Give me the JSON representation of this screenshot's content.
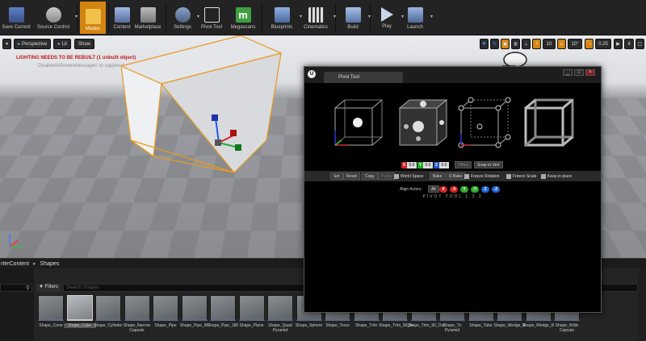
{
  "toolbar": {
    "items": [
      {
        "label": "Save Current",
        "icon": "save-icon"
      },
      {
        "label": "Source Control",
        "icon": "source-control-icon"
      },
      {
        "label": "Modes",
        "icon": "modes-icon"
      },
      {
        "label": "Content",
        "icon": "content-icon"
      },
      {
        "label": "Marketplace",
        "icon": "marketplace-icon"
      },
      {
        "label": "Settings",
        "icon": "settings-icon"
      },
      {
        "label": "Pivot Tool",
        "icon": "pivot-tool-icon"
      },
      {
        "label": "Megascans",
        "icon": "megascans-icon"
      },
      {
        "label": "Blueprints",
        "icon": "blueprints-icon"
      },
      {
        "label": "Cinematics",
        "icon": "cinematics-icon"
      },
      {
        "label": "Build",
        "icon": "build-icon"
      },
      {
        "label": "Play",
        "icon": "play-icon"
      },
      {
        "label": "Launch",
        "icon": "launch-icon"
      }
    ],
    "active_color": "#d48410"
  },
  "viewport": {
    "perspective_label": "Perspective",
    "lit_label": "Lit",
    "show_label": "Show",
    "warning": "LIGHTING NEEDS TO BE REBUILT (1 unbuilt object)",
    "warning_sub": "'DisableAllScreenMessages' to suppress",
    "grid_snap": "10",
    "rot_snap": "10°",
    "scale_snap": "0.25",
    "camera_speed": "4"
  },
  "content_browser": {
    "path_root": "rterContent",
    "path_leaf": "Shapes",
    "filters_label": "Filters",
    "search_placeholder": "Search Shapes",
    "assets": [
      "Shape_Cone",
      "Shape_Cube",
      "Shape_Cylinder",
      "Shape_Narrow Capsule",
      "Shape_Pipe",
      "Shape_Pipe_90",
      "Shape_Pipe_180",
      "Shape_Plane",
      "Shape_Quad Pyramid",
      "Shape_Sphere",
      "Shape_Torus",
      "Shape_Trim",
      "Shape_Trim_90_In",
      "Shape_Trim_90_Out",
      "Shape_Tri Pyramid",
      "Shape_Tube",
      "Shape_Wedge_A",
      "Shape_Wedge_B",
      "Shape_Wide Capsule"
    ]
  },
  "pivot_window": {
    "tab_title": "Pivot Tool",
    "ue_glyph": "U",
    "minimize": "_",
    "maximize": "□",
    "close": "×",
    "x_label": "X",
    "x_value": "0.0",
    "y_label": "Y",
    "y_value": "0.0",
    "z_label": "Z",
    "z_value": "0.0",
    "offset_label": "Offset",
    "snap_label": "Snap to Vert",
    "buttons": {
      "set": "Set",
      "reset": "Reset",
      "copy": "Copy",
      "paste": "Paste",
      "bake": "Bake",
      "dbake": "D.Bake"
    },
    "checks": {
      "world": "World Space",
      "freeze_rot": "Freeze Rotation",
      "freeze_scale": "Freeze Scale",
      "keep": "Keep in place"
    },
    "align_label": "Align Actors:",
    "align_all": "All",
    "align": [
      {
        "t": "X",
        "c": "#d32020"
      },
      {
        "t": "-X",
        "c": "#d32020"
      },
      {
        "t": "Y",
        "c": "#2fa82f"
      },
      {
        "t": "-Y",
        "c": "#2fa82f"
      },
      {
        "t": "Z",
        "c": "#2264d6"
      },
      {
        "t": "-Z",
        "c": "#2264d6"
      }
    ],
    "footer": "PIVOT TOOL 1.3.3"
  }
}
